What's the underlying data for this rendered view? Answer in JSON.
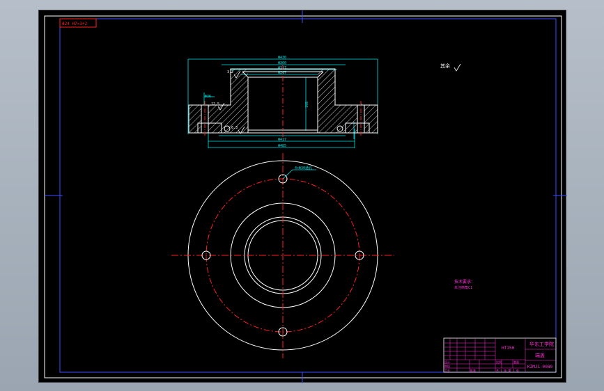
{
  "drawing": {
    "ref_stamp": "Φ24 H7×3+2",
    "surface_finish_note": "其余",
    "dimensions": {
      "top_d1": "Φ430",
      "top_d2": "Φ360",
      "top_d3": "Φ317",
      "top_d4": "Φ287",
      "left_small": "Φ36",
      "bottom_d1": "Φ417",
      "bottom_d2": "Φ485",
      "height_main": "195",
      "right_h1": "30",
      "hole_callout": "4×Φ30通孔"
    },
    "roughness": [
      "3.2",
      "12.5",
      "6.3"
    ],
    "tech_notes": {
      "line1": "技术要求：",
      "line2": "未注倒角C1"
    },
    "title_block": {
      "material": "HT150",
      "school": "华东工学院",
      "part_name": "端盖",
      "drawing_no": "KZMJ1-0080",
      "label_designer": "设计",
      "label_check": "审核",
      "label_process": "工艺",
      "label_approve": "批准",
      "label_scale": "比例",
      "label_weight": "重量",
      "label_sheet": "共 1 张 第 1 张"
    }
  },
  "colors": {
    "line": "#ffffff",
    "dim": "#00e5e5",
    "center": "#ff2020",
    "hatch": "#d0d0d0",
    "annotation": "#ff2fd8",
    "border": "#3a4dff",
    "marker": "#3a4dff"
  }
}
